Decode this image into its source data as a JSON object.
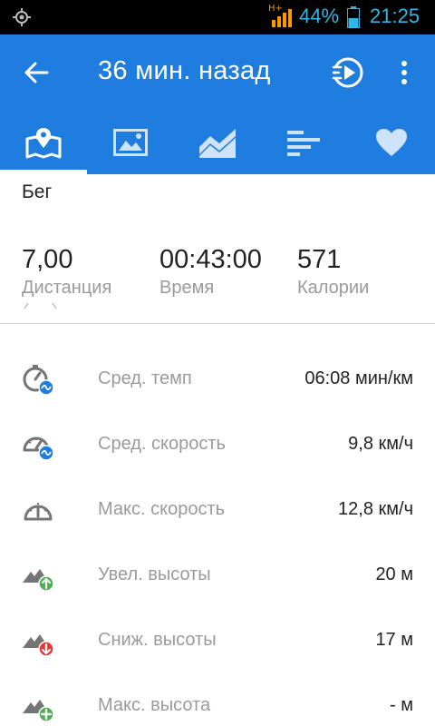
{
  "status_bar": {
    "network": "H+",
    "battery_percent": "44%",
    "time": "21:25",
    "accent_color": "#33b5e5"
  },
  "app_bar": {
    "title": "36 мин. назад",
    "color": "#1f7de0",
    "icons": [
      "back-arrow-icon",
      "play-route-icon",
      "more-vert-icon"
    ]
  },
  "tabs": {
    "items": [
      {
        "icon": "map-icon",
        "selected": true
      },
      {
        "icon": "image-icon",
        "selected": false
      },
      {
        "icon": "area-chart-icon",
        "selected": false
      },
      {
        "icon": "bar-list-icon",
        "selected": false
      },
      {
        "icon": "heart-icon",
        "selected": false
      }
    ]
  },
  "activity": {
    "type": "Бег"
  },
  "summary": {
    "distance_value": "7,00",
    "distance_label": "Дистанция",
    "time_value": "00:43:00",
    "time_label": "Время",
    "calories_value": "571",
    "calories_label": "Калории"
  },
  "stats": {
    "rows": [
      {
        "label": "Сред. темп",
        "value": "06:08 мин/км",
        "icon": "avg-pace-icon"
      },
      {
        "label": "Сред. скорость",
        "value": "9,8 км/ч",
        "icon": "avg-speed-icon"
      },
      {
        "label": "Макс. скорость",
        "value": "12,8 км/ч",
        "icon": "max-speed-icon"
      },
      {
        "label": "Увел. высоты",
        "value": "20 м",
        "icon": "elevation-gain-icon"
      },
      {
        "label": "Сниж. высоты",
        "value": "17 м",
        "icon": "elevation-loss-icon"
      },
      {
        "label": "Макс. высота",
        "value": "- м",
        "icon": "max-elevation-icon"
      }
    ]
  }
}
